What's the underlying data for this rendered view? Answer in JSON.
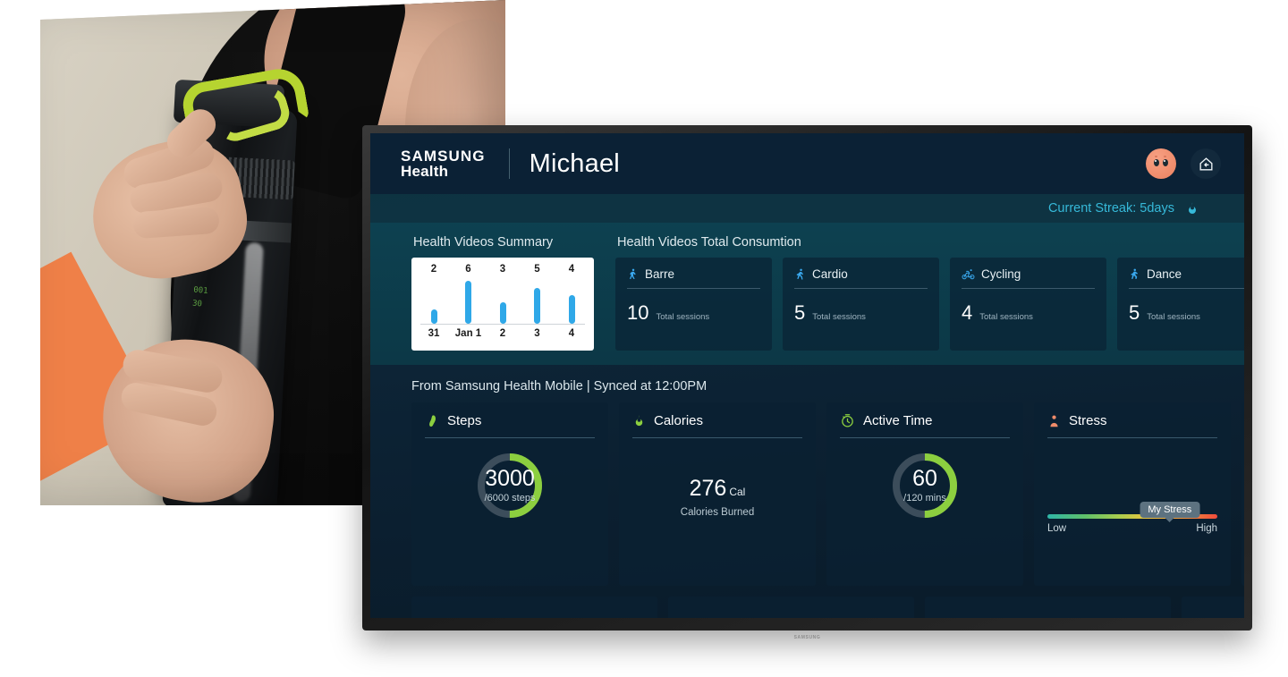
{
  "photo": {
    "alt": "Woman in black athletic top opening a dark sports water bottle with a green cap"
  },
  "tv": {
    "brand_logo": "SAMSUNG"
  },
  "header": {
    "brand_line1": "SAMSUNG",
    "brand_line2": "Health",
    "user_name": "Michael",
    "avatar_icon": "user-avatar-face-icon",
    "home_icon": "home-back-icon"
  },
  "streak": {
    "text": "Current Streak: 5days",
    "flame_icon": "flame-icon",
    "color": "#36b9d9"
  },
  "videos_summary": {
    "title": "Health Videos Summary"
  },
  "chart_data": {
    "type": "bar",
    "title": "Health Videos Summary",
    "categories": [
      "31",
      "Jan 1",
      "2",
      "3",
      "4"
    ],
    "values": [
      2,
      6,
      3,
      5,
      4
    ],
    "value_labels": [
      "2",
      "6",
      "3",
      "5",
      "4"
    ],
    "xlabel": "",
    "ylabel": "",
    "ylim": [
      0,
      6
    ],
    "grid": false,
    "legend": "none",
    "bar_color": "#2fa8e8",
    "background": "#ffffff"
  },
  "videos_consumption": {
    "title": "Health Videos Total Consumtion",
    "unit_label": "Total sessions",
    "cards": [
      {
        "label": "Barre",
        "icon": "barre-figure-icon",
        "value": "10"
      },
      {
        "label": "Cardio",
        "icon": "running-figure-icon",
        "value": "5"
      },
      {
        "label": "Cycling",
        "icon": "bicycle-icon",
        "value": "4"
      },
      {
        "label": "Dance",
        "icon": "dancing-figure-icon",
        "value": "5"
      }
    ]
  },
  "mobile_section": {
    "sync_text": "From Samsung Health Mobile | Synced at 12:00PM",
    "steps": {
      "label": "Steps",
      "icon": "shoe-footprint-icon",
      "value": "3000",
      "goal": "/6000 steps",
      "percent": 50,
      "ring_color": "#8ccf3f"
    },
    "calories": {
      "label": "Calories",
      "icon": "flame-green-icon",
      "value": "276",
      "unit": "Cal",
      "caption": "Calories Burned"
    },
    "active_time": {
      "label": "Active Time",
      "icon": "stopwatch-icon",
      "value": "60",
      "goal": "/120 mins",
      "percent": 50,
      "ring_color": "#8ccf3f"
    },
    "stress": {
      "label": "Stress",
      "icon": "stressed-person-icon",
      "marker_label": "My Stress",
      "marker_percent": 72,
      "low_label": "Low",
      "high_label": "High"
    },
    "sleep_partial": {
      "label": "",
      "icon": "moon-sleep-icon"
    }
  }
}
